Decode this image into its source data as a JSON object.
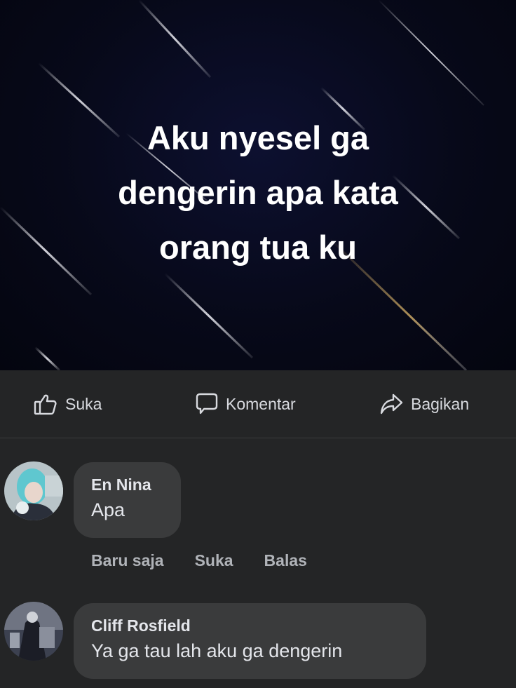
{
  "post": {
    "text_lines": [
      "Aku nyesel ga",
      "dengerin apa kata",
      "orang tua ku"
    ]
  },
  "actions": {
    "like": "Suka",
    "comment": "Komentar",
    "share": "Bagikan"
  },
  "comments": [
    {
      "name": "En Nina",
      "text": "Apa",
      "time": "Baru saja",
      "like": "Suka",
      "reply": "Balas"
    },
    {
      "name": "Cliff Rosfield",
      "text": "Ya ga tau lah aku ga dengerin"
    }
  ],
  "colors": {
    "background": "#242526",
    "bubble": "#3a3b3c",
    "text": "#e4e6eb",
    "secondary_text": "#b0b3b8"
  }
}
